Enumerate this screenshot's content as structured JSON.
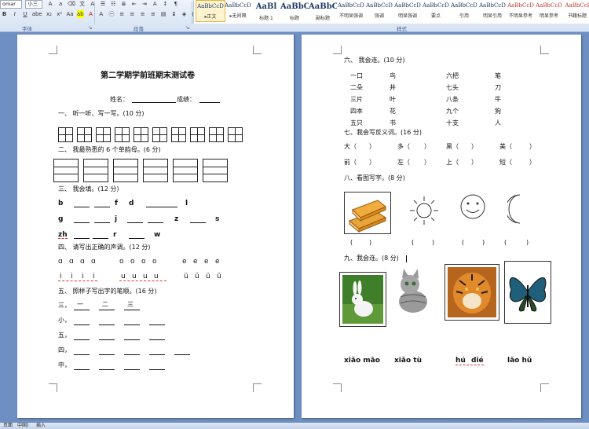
{
  "ribbon": {
    "font_name": "omar",
    "font_size": "小三",
    "paragraph_group": "段落",
    "font_group": "字体",
    "styles_group": "样式",
    "styles": [
      {
        "preview": "AaBbCcD",
        "name": "▸正文"
      },
      {
        "preview": "AaBbCcD",
        "name": "▸无间隔"
      },
      {
        "preview": "AaBl",
        "name": "标题 1"
      },
      {
        "preview": "AaBbC",
        "name": "标题"
      },
      {
        "preview": "AaBbC",
        "name": "副标题"
      },
      {
        "preview": "AaBbCcD",
        "name": "不明显强调"
      },
      {
        "preview": "AaBbCcD",
        "name": "强调"
      },
      {
        "preview": "AaBbCcD",
        "name": "明显强调"
      },
      {
        "preview": "AaBbCcD",
        "name": "要点"
      },
      {
        "preview": "AaBbCcD",
        "name": "引用"
      },
      {
        "preview": "AaBbCcD",
        "name": "明显引用"
      },
      {
        "preview": "AaBbCcD",
        "name": "不明显参考"
      },
      {
        "preview": "AaBbCcD",
        "name": "明显参考"
      },
      {
        "preview": "AaBbCcI",
        "name": "书籍标题"
      }
    ]
  },
  "page1": {
    "title": "第二学期学前班期末测试卷",
    "name_label": "姓名：",
    "score_label": "成绩：",
    "q1": "一、 听一听、写一写。(10 分)",
    "q2": "二、 我最熟悉的 6 个单韵母。(6 分)",
    "q3": "三、 我会填。(12 分)",
    "q3_rows": [
      [
        "b",
        "f",
        "d",
        "l"
      ],
      [
        "g",
        "j",
        "z",
        "s"
      ],
      [
        "zh",
        "r",
        "w"
      ]
    ],
    "q4": "四、 请写出正确的声调。(12 分)",
    "q4_top": [
      "ɑ",
      "ɑ",
      "ɑ",
      "ɑ",
      "o",
      "o",
      "o",
      "o",
      "e",
      "e",
      "e",
      "e"
    ],
    "q4_bottom": [
      "i",
      "i",
      "i",
      "i",
      "u",
      "u",
      "u",
      "u",
      "ü",
      "ü",
      "ü",
      "ü"
    ],
    "q5": "五、 照样子写出字的笔顺。(16 分)",
    "q5_chars": [
      "三，",
      "小，",
      "五，",
      "四，",
      "中，"
    ],
    "q5_example": [
      "一",
      "二",
      "三"
    ]
  },
  "page2": {
    "q6": "六、 我会连。(10 分)",
    "q6_left": [
      "一口",
      "二朵",
      "三片",
      "四本",
      "五只"
    ],
    "q6_mid": [
      "鸟",
      "井",
      "叶",
      "花",
      "书"
    ],
    "q6_right": [
      "六把",
      "七头",
      "八条",
      "九个",
      "十支"
    ],
    "q6_far": [
      "笔",
      "刀",
      "牛",
      "狗",
      "人"
    ],
    "q7": "七、我会写反义词。(16 分)",
    "q7_row1": [
      "大（",
      "）",
      "多（",
      "）",
      "黑（",
      "）",
      "美（",
      "）"
    ],
    "q7_row2": [
      "前（",
      "）",
      "左（",
      "）",
      "上（",
      "）",
      "短（",
      "）"
    ],
    "q8": "八、看图写字。(8 分)",
    "q8_parens": [
      "(",
      ")",
      "(",
      ")",
      "(",
      ")",
      "(",
      ")"
    ],
    "q9": "九、我会连。(8 分)",
    "q9_pinyin": [
      "xiǎo māo",
      "xiǎo tù",
      "hú",
      "dié",
      "lǎo hǔ"
    ]
  },
  "status": {
    "page": "页面",
    "lang": "中国)",
    "mode": "插入"
  }
}
